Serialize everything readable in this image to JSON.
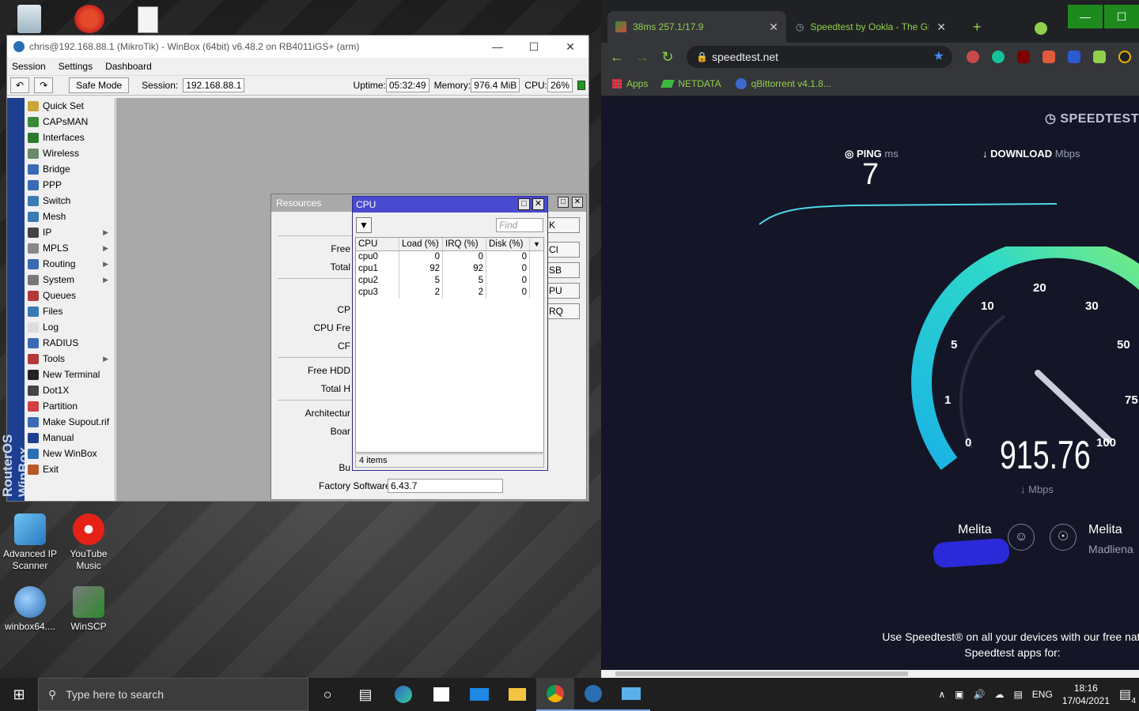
{
  "desktop": {
    "icons": [
      {
        "label": "Advanced IP Scanner"
      },
      {
        "label": "YouTube Music"
      },
      {
        "label": "winbox64...."
      },
      {
        "label": "WinSCP"
      }
    ]
  },
  "winbox": {
    "title": "chris@192.168.88.1 (MikroTik) - WinBox (64bit) v6.48.2 on RB4011iGS+ (arm)",
    "menu": [
      "Session",
      "Settings",
      "Dashboard"
    ],
    "safe_mode": "Safe Mode",
    "session_label": "Session:",
    "session_value": "192.168.88.1",
    "uptime_label": "Uptime:",
    "uptime_value": "05:32:49",
    "memory_label": "Memory:",
    "memory_value": "976.4 MiB",
    "cpu_label": "CPU:",
    "cpu_value": "26%",
    "vertical_brand": "RouterOS WinBox",
    "sidebar": [
      {
        "label": "Quick Set",
        "icon": "quickset-icon",
        "color": "#caa53a"
      },
      {
        "label": "CAPsMAN",
        "icon": "capsman-icon",
        "color": "#3a8a3a"
      },
      {
        "label": "Interfaces",
        "icon": "interfaces-icon",
        "color": "#2d7a2d"
      },
      {
        "label": "Wireless",
        "icon": "wireless-icon",
        "color": "#6a8a6a"
      },
      {
        "label": "Bridge",
        "icon": "bridge-icon",
        "color": "#3a6ab4"
      },
      {
        "label": "PPP",
        "icon": "ppp-icon",
        "color": "#3a6ab4"
      },
      {
        "label": "Switch",
        "icon": "switch-icon",
        "color": "#3a7ab4"
      },
      {
        "label": "Mesh",
        "icon": "mesh-icon",
        "color": "#3a7ab4"
      },
      {
        "label": "IP",
        "icon": "ip-icon",
        "color": "#444444",
        "sub": true
      },
      {
        "label": "MPLS",
        "icon": "mpls-icon",
        "color": "#888888",
        "sub": true
      },
      {
        "label": "Routing",
        "icon": "routing-icon",
        "color": "#3a6ab4",
        "sub": true
      },
      {
        "label": "System",
        "icon": "system-icon",
        "color": "#777777",
        "sub": true
      },
      {
        "label": "Queues",
        "icon": "queues-icon",
        "color": "#b43a3a"
      },
      {
        "label": "Files",
        "icon": "files-icon",
        "color": "#3a7ab4"
      },
      {
        "label": "Log",
        "icon": "log-icon",
        "color": "#dddddd"
      },
      {
        "label": "RADIUS",
        "icon": "radius-icon",
        "color": "#3a6ab4"
      },
      {
        "label": "Tools",
        "icon": "tools-icon",
        "color": "#b43a3a",
        "sub": true
      },
      {
        "label": "New Terminal",
        "icon": "terminal-icon",
        "color": "#222222"
      },
      {
        "label": "Dot1X",
        "icon": "dot1x-icon",
        "color": "#444444"
      },
      {
        "label": "Partition",
        "icon": "partition-icon",
        "color": "#d04040"
      },
      {
        "label": "Make Supout.rif",
        "icon": "supout-icon",
        "color": "#3a6ab4"
      },
      {
        "label": "Manual",
        "icon": "manual-icon",
        "color": "#1d3f8f"
      },
      {
        "label": "New WinBox",
        "icon": "newwinbox-icon",
        "color": "#2a6fb4"
      },
      {
        "label": "Exit",
        "icon": "exit-icon",
        "color": "#b45a2a"
      }
    ]
  },
  "resources": {
    "title": "Resources",
    "rows": [
      "Free",
      "Total",
      "CP",
      "CPU Fre",
      "CF",
      "Free HDD",
      "Total H",
      "Architectur",
      "Boar",
      "Bu"
    ],
    "factory_label": "Factory Software:",
    "factory_value": "6.43.7",
    "buttons": [
      "K",
      "CI",
      "SB",
      "PU",
      "RQ"
    ]
  },
  "cpu_window": {
    "title": "CPU",
    "find_placeholder": "Find",
    "columns": [
      "CPU",
      "Load (%)",
      "IRQ (%)",
      "Disk (%)"
    ],
    "rows": [
      [
        "cpu0",
        "0",
        "0",
        "0"
      ],
      [
        "cpu1",
        "92",
        "92",
        "0"
      ],
      [
        "cpu2",
        "5",
        "5",
        "0"
      ],
      [
        "cpu3",
        "2",
        "2",
        "0"
      ]
    ],
    "footer": "4 items"
  },
  "chrome": {
    "tabs": [
      {
        "title": "38ms 257.1/17.9"
      },
      {
        "title": "Speedtest by Ookla - The Glob"
      }
    ],
    "url": "speedtest.net",
    "bookmarks": [
      "Apps",
      "NETDATA",
      "qBittorrent v4.1.8..."
    ],
    "accent": "#8fd04a"
  },
  "speedtest": {
    "brand": "SPEEDTEST",
    "ping_label": "PING",
    "ping_unit": "ms",
    "ping_value": "7",
    "download_label": "DOWNLOAD",
    "download_unit": "Mbps",
    "speed_value": "915.76",
    "speed_unit": "Mbps",
    "gauge_ticks": [
      "0",
      "1",
      "5",
      "10",
      "20",
      "30",
      "50",
      "75",
      "100"
    ],
    "isp_name": "Melita",
    "server_name": "Melita",
    "server_location": "Madliena",
    "promo_line1": "Use Speedtest® on all your devices with our free nati",
    "promo_line2": "Speedtest apps for:"
  },
  "taskbar": {
    "search_placeholder": "Type here to search",
    "language": "ENG",
    "time": "18:16",
    "date": "17/04/2021",
    "notifications": "4"
  }
}
